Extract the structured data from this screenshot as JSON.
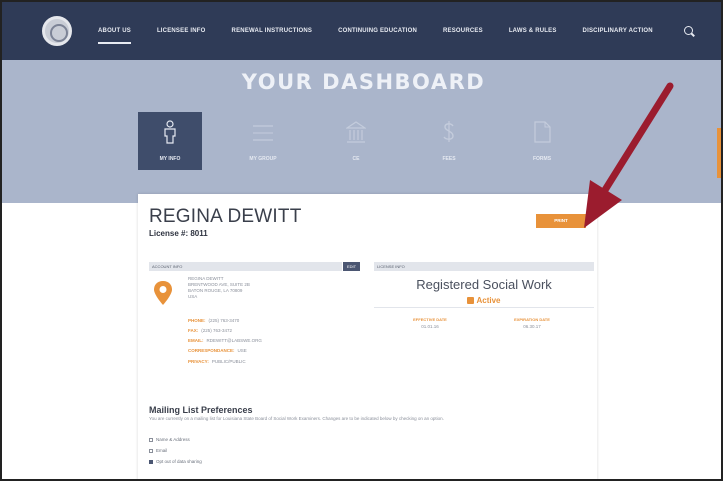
{
  "nav": {
    "links": [
      "ABOUT US",
      "LICENSEE INFO",
      "RENEWAL INSTRUCTIONS",
      "CONTINUING EDUCATION",
      "RESOURCES",
      "LAWS & RULES",
      "DISCIPLINARY ACTION"
    ],
    "active_index": 0,
    "icons": {
      "seal": "state-seal-logo",
      "search": "search-icon"
    }
  },
  "dashboard": {
    "title": "YOUR DASHBOARD",
    "tabs": [
      {
        "label": "MY INFO",
        "icon": "person-icon",
        "active": true
      },
      {
        "label": "MY GROUP",
        "icon": "group-icon",
        "active": false
      },
      {
        "label": "CE",
        "icon": "building-icon",
        "active": false
      },
      {
        "label": "FEES",
        "icon": "dollar-icon",
        "active": false
      },
      {
        "label": "FORMS",
        "icon": "document-icon",
        "active": false
      }
    ]
  },
  "profile": {
    "name": "REGINA DEWITT",
    "license": "License #: 8011",
    "print_label": "PRINT",
    "account_info_header": "ACCOUNT INFO",
    "edit_label": "EDIT",
    "license_info_header": "LICENSE INFO",
    "address_lines": [
      "REGINA DEWITT",
      "BRENTWOOD AVE, SUITE 2B",
      "BATON ROUGE, LA 70809",
      "USA"
    ],
    "fields": [
      {
        "label": "PHONE:",
        "value": "(225) 763-3470"
      },
      {
        "label": "FAX:",
        "value": "(225) 763-3472"
      },
      {
        "label": "EMAIL:",
        "value": "RDEWITT@LABSWE.ORG"
      },
      {
        "label": "CORRESPONDANCE:",
        "value": "USE"
      },
      {
        "label": "PRIVACY:",
        "value": "PUBLIC/PUBLIC"
      }
    ],
    "license_type": "Registered Social Work",
    "status": "Active",
    "effective": {
      "label": "EFFECTIVE DATE",
      "value": "01.01.16"
    },
    "expiration": {
      "label": "EXPIRATION DATE",
      "value": "06.30.17"
    }
  },
  "mailing": {
    "title": "Mailing List Preferences",
    "description": "You are currently on a mailing list for Louisiana State Board of Social Work Examiners. Changes are to be indicated below by checking on an option.",
    "options": [
      {
        "label": "Name & Address",
        "checked": false
      },
      {
        "label": "Email",
        "checked": false
      },
      {
        "label": "Opt out of data sharing",
        "checked": true
      }
    ]
  },
  "colors": {
    "nav": "#2f3b57",
    "band": "#aab5cb",
    "accent": "#e8923a",
    "arrow": "#9b1c2e"
  }
}
